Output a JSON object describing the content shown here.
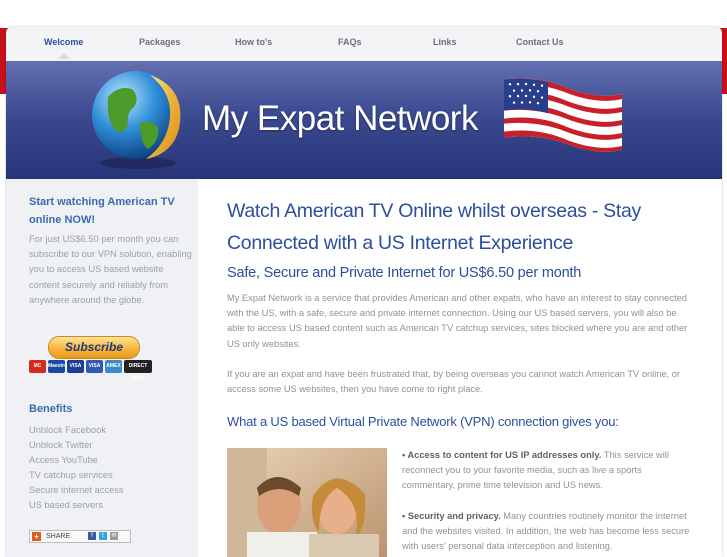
{
  "nav": {
    "items": [
      {
        "label": "Welcome"
      },
      {
        "label": "Packages"
      },
      {
        "label": "How to's"
      },
      {
        "label": "FAQs"
      },
      {
        "label": "Links"
      },
      {
        "label": "Contact Us"
      }
    ]
  },
  "banner": {
    "title": "My Expat Network"
  },
  "sidebar": {
    "promo_title": "Start watching American TV online NOW!",
    "promo_text": "For just US$6.50 per month you can subscribe to our VPN solution, enabling you to access US based website content securely and reliably from anywhere around the globe.",
    "subscribe_label": "Subscribe",
    "cards": [
      "MC",
      "Maestro",
      "VISA",
      "VISA",
      "AMEX",
      "DIRECT DEBIT"
    ],
    "benefits_title": "Benefits",
    "benefits": [
      "Unblock Facebook",
      "Unblock Twitter",
      "Access YouTube",
      "TV catchup services",
      "Secure internet access",
      "US based servers"
    ],
    "share_label": "SHARE"
  },
  "main": {
    "heading": "Watch American TV Online whilst overseas - Stay Connected with a US Internet Experience",
    "subheading": "Safe, Secure and Private Internet for US$6.50 per month",
    "paragraph1": "My Expat Network is a service that provides American and other expats, who have an interest to stay connected with the US, with a safe, secure and private internet connection. Using our US based servers, you will also be able to access US based content such as American TV catchup services, sites blocked where you are and other US only websites.",
    "paragraph2": "If you are an expat and have been frustrated that, by being overseas you cannot watch American TV online, or access some US websites, then you have come to right place.",
    "vpn_heading": "What a US based Virtual Private Network (VPN) connection gives you:",
    "bullets": [
      {
        "title": "• Access to content for US IP addresses only.",
        "text": " This service will reconnect you to your favorite media, such as live a sports commentary, prime time television and US news."
      },
      {
        "title": "• Security and privacy.",
        "text": " Many countries routinely monitor the internet and the websites visited. In addition, the web has become less secure with users' personal data interception and listening."
      }
    ]
  },
  "colors": {
    "brand_red": "#c8101a",
    "heading_blue": "#2b4f9c",
    "banner_blue": "#3c4a91"
  }
}
